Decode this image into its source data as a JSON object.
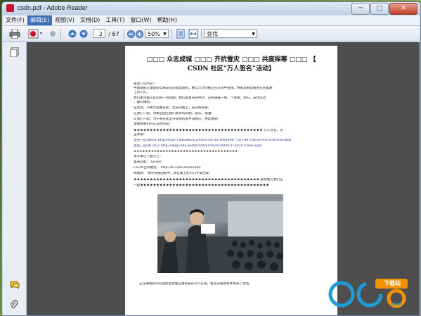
{
  "window": {
    "title": "csdn.pdf - Adobe Reader",
    "controls": {
      "minimize": "─",
      "maximize": "□",
      "close": "✕"
    }
  },
  "menubar": {
    "items": [
      {
        "label": "文件(F)"
      },
      {
        "label": "编辑(E)"
      },
      {
        "label": "视图(V)"
      },
      {
        "label": "文档(D)"
      },
      {
        "label": "工具(T)"
      },
      {
        "label": "窗口(W)"
      },
      {
        "label": "帮助(H)"
      }
    ],
    "active_index": 1
  },
  "toolbar": {
    "current_page": "2",
    "total_pages": "/ 67",
    "zoom": "50%",
    "search_placeholder": "查找",
    "icons": [
      "print-icon",
      "email-icon",
      "page-up-icon",
      "page-down-icon",
      "zoom-out-icon",
      "zoom-in-icon",
      "fit-page-icon",
      "fit-width-icon"
    ]
  },
  "sidebar": {
    "icons": [
      "pages-icon",
      "comments-icon",
      "attachments-icon"
    ]
  },
  "document": {
    "title_line1": "□□□ 众志成城 □□□ 齐抗雪灾 □□□ 共度探寒 □□□ 【",
    "title_line2": "CSDN 社区“万人签名”活动】",
    "body_lines": [
      "各位CSDNer:",
      "中国南部正遭遇多年来罕见的极度雨雪，数以万计同胞正在风雪中受困，特别是那些被困在回家路",
      "上的人们。",
      "我们关注着灾区的每一位同胞，我们愿意同舟共济，已经来临一线，个谢谢，南方，安然度过",
      "，都问候吧。",
      "在此刻，不要大家都在此，出去的路上，成已经到家。",
      "让我们一起，为那些困在我们家乡的同胞，送去，加油！",
      "让我们一起，为宁愿在此坚守等待的家乡同胞们，共度难关！",
      "请确保我们的心与你同在！",
      "★★★★★★★★★★★★★★★★★★★★★★★★★★★★★★★★★★★★★★★★ 万人签名，点",
      "击参加：",
      "签名一区(BBS): http://topic.csdn.net/u/20080130/16/7d4df496-72d1-487f-b63e-e010c5e91f8.html",
      "签名二区(BLOG): http://blog.csdn.net/hicsdn/archive/2008/01/30/2071664.aspx",
      "★★★★★★★★★★★★★★★★★★★★★★★★★★★★★★★★★★★★",
      "请大家在下面写上：",
      "发表回复：                              hicsdn",
      "CSDN空间地址：                         http://hi.csdn.net/hicsdn",
      "祝福语：                   祝所有被困家中，请在路上的人们平安回家！",
      "★★★★★★★★★★★★★★★★★★★★★★★★★★★★★★★★★★★★★★★ 愿总理与我们在",
      "一起★★★★★★★★★★★★★★★★★★★★★★★★★★★★★★★★★★★★★★★★"
    ],
    "caption": "正在湖南慰问的温家宝总理在湖南省长沙火车站，看望滞留旅客并发表了讲话。"
  },
  "watermark": {
    "logo_text": "pc6",
    "badge_text": "下载站",
    "url": "com"
  },
  "colors": {
    "accent": "#3d6db8",
    "close": "#c2402a",
    "logo_blue": "#1f9bd6",
    "logo_orange": "#f39200"
  }
}
